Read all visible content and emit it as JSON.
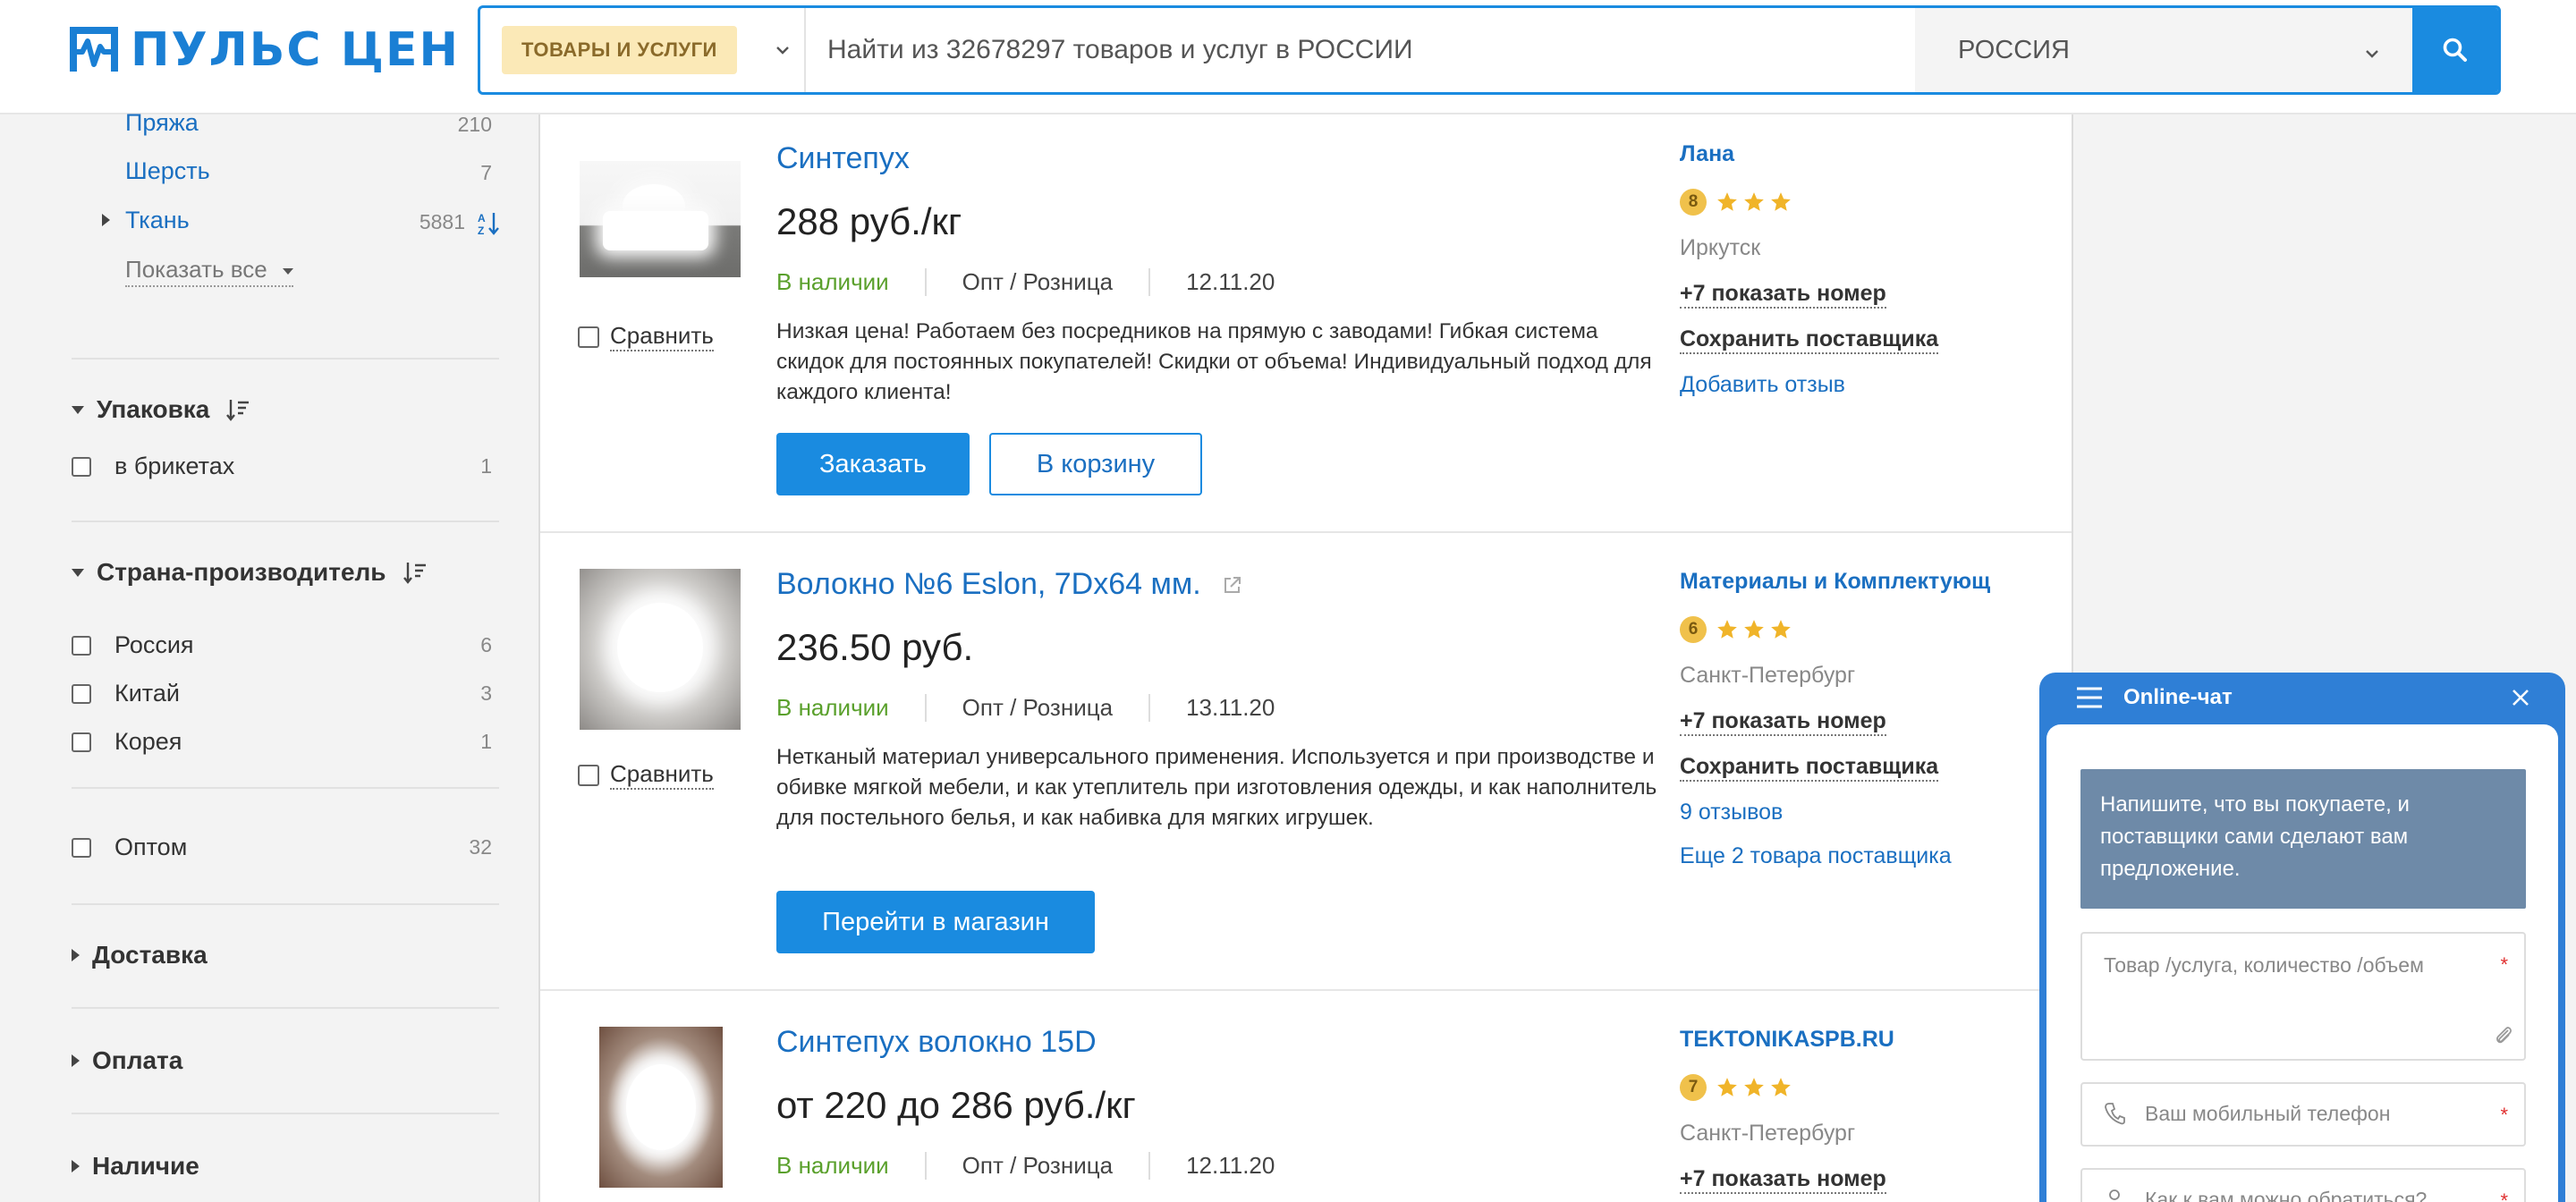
{
  "header": {
    "logo_text": "ПУЛЬС ЦЕН",
    "category_chip": "ТОВАРЫ И УСЛУГИ",
    "search_placeholder": "Найти из 32678297 товаров и услуг в РОССИИ",
    "region": "РОССИЯ",
    "accent_color": "#1a8be0"
  },
  "sidebar": {
    "categories": [
      {
        "label": "Пряжа",
        "count": "210"
      },
      {
        "label": "Шерсть",
        "count": "7"
      },
      {
        "label": "Ткань",
        "count": "5881"
      }
    ],
    "show_all": "Показать все",
    "packaging": {
      "title": "Упаковка",
      "options": [
        {
          "label": "в брикетах",
          "count": "1"
        }
      ]
    },
    "country": {
      "title": "Страна-производитель",
      "options": [
        {
          "label": "Россия",
          "count": "6"
        },
        {
          "label": "Китай",
          "count": "3"
        },
        {
          "label": "Корея",
          "count": "1"
        }
      ]
    },
    "wholesale": {
      "label": "Оптом",
      "count": "32"
    },
    "delivery": "Доставка",
    "payment": "Оплата",
    "availability": "Наличие"
  },
  "products": [
    {
      "title": "Синтепух",
      "price": "288 руб./кг",
      "stock": "В наличии",
      "type": "Опт / Розница",
      "date": "12.11.20",
      "compare": "Сравнить",
      "description": "Низкая цена! Работаем без посредников на прямую с заводами! Гибкая система скидок для постоянных покупателей! Скидки от объема! Индивидуальный подход для каждого клиента!",
      "btn_primary": "Заказать",
      "btn_secondary": "В корзину",
      "seller": {
        "name": "Лана",
        "rating": "8",
        "stars": 3,
        "city": "Иркутск",
        "phone": "+7 показать номер",
        "save": "Сохранить поставщика",
        "link1": "Добавить отзыв"
      }
    },
    {
      "title": "Волокно №6 Eslon, 7Dx64 мм.",
      "price": "236.50 руб.",
      "stock": "В наличии",
      "type": "Опт / Розница",
      "date": "13.11.20",
      "compare": "Сравнить",
      "description": "Нетканый материал универсального применения. Используется и при производстве и обивке мягкой мебели, и как утеплитель при изготовления одежды, и как наполнитель для постельного белья, и как набивка для мягких игрушек.",
      "btn_primary": "Перейти в магазин",
      "seller": {
        "name": "Материалы и Комплектующ",
        "rating": "6",
        "stars": 3,
        "city": "Санкт-Петербург",
        "phone": "+7 показать номер",
        "save": "Сохранить поставщика",
        "link1": "9 отзывов",
        "link2": "Еще 2 товара поставщика"
      }
    },
    {
      "title": "Синтепух волокно 15D",
      "price": "от 220 до 286 руб./кг",
      "stock": "В наличии",
      "type": "Опт / Розница",
      "date": "12.11.20",
      "seller": {
        "name": "TEKTONIKASPB.RU",
        "rating": "7",
        "stars": 3,
        "city": "Санкт-Петербург",
        "phone": "+7 показать номер"
      }
    }
  ],
  "chat": {
    "title": "Online-чат",
    "message": "Напишите, что вы покупаете, и поставщики сами сделают вам предложение.",
    "field_product": "Товар /услуга, количество /объем",
    "field_phone": "Ваш мобильный телефон",
    "field_name": "Как к вам можно обратиться?",
    "required_mark": "*"
  }
}
